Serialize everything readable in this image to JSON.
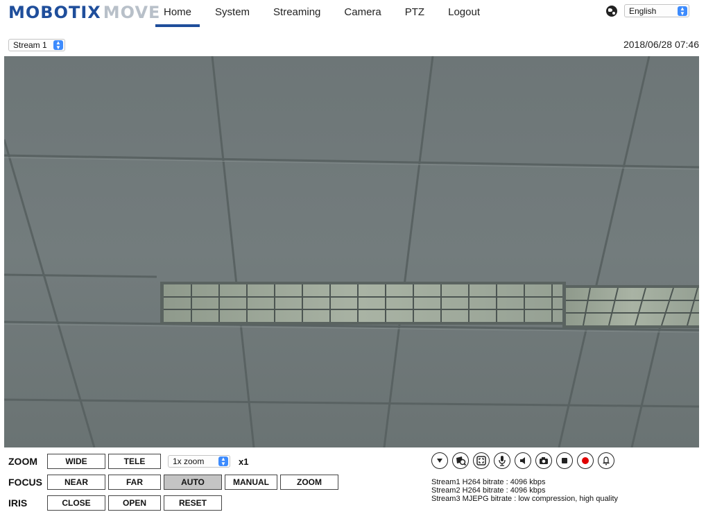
{
  "header": {
    "logo_main": "MOBOTIX",
    "logo_sub": "MOVE",
    "nav": [
      "Home",
      "System",
      "Streaming",
      "Camera",
      "PTZ",
      "Logout"
    ],
    "language": "English"
  },
  "subbar": {
    "stream_select": "Stream 1",
    "datetime": "2018/06/28 07:46"
  },
  "controls": {
    "zoom": {
      "label": "ZOOM",
      "wide": "WIDE",
      "tele": "TELE",
      "zoom_select": "1x zoom",
      "zoom_level": "x1"
    },
    "focus": {
      "label": "FOCUS",
      "near": "NEAR",
      "far": "FAR",
      "auto": "AUTO",
      "manual": "MANUAL",
      "zoom": "ZOOM"
    },
    "iris": {
      "label": "IRIS",
      "close": "CLOSE",
      "open": "OPEN",
      "reset": "RESET"
    }
  },
  "toolbar_icons": [
    "dropdown-icon",
    "privacy-mask-icon",
    "fullscreen-icon",
    "microphone-icon",
    "speaker-icon",
    "snapshot-icon",
    "stop-icon",
    "record-icon",
    "alarm-bell-icon"
  ],
  "colors": {
    "brand": "#1f4e9b",
    "record": "#e00000",
    "active_button": "#c4c4c4"
  },
  "stream_info": [
    "Stream1 H264 bitrate : 4096 kbps",
    "Stream2 H264 bitrate : 4096 kbps",
    "Stream3 MJEPG bitrate : low compression, high quality"
  ]
}
